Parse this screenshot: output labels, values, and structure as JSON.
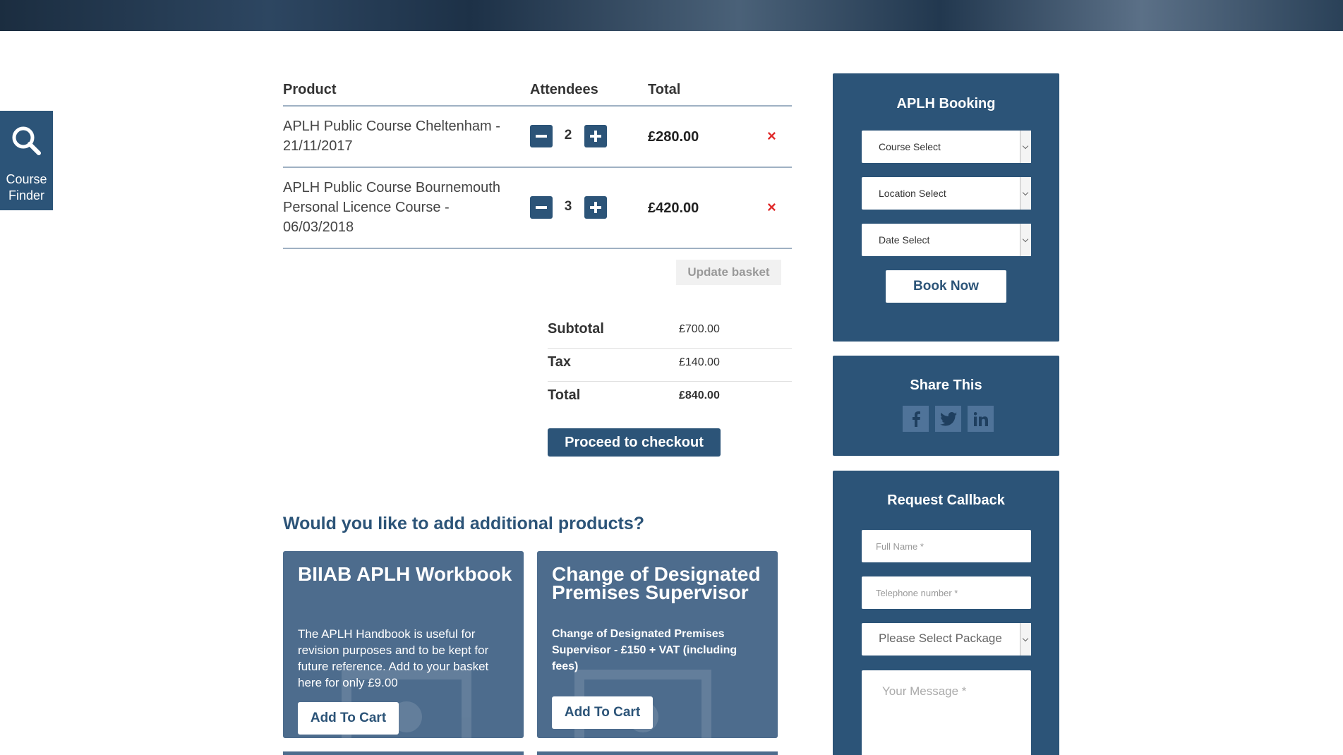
{
  "course_finder": {
    "label_line1": "Course",
    "label_line2": "Finder",
    "icon": "search-icon"
  },
  "cart": {
    "headers": {
      "product": "Product",
      "attendees": "Attendees",
      "total": "Total"
    },
    "items": [
      {
        "name_line1": "APLH Public Course Cheltenham -",
        "name_line2": "21/11/2017",
        "name_line3": "",
        "qty": "2",
        "total": "£280.00",
        "remove": "×"
      },
      {
        "name_line1": "APLH Public Course Bournemouth",
        "name_line2": "Personal Licence Course -",
        "name_line3": "06/03/2018",
        "qty": "3",
        "total": "£420.00",
        "remove": "×"
      }
    ],
    "update_label": "Update basket"
  },
  "totals": {
    "subtotal_label": "Subtotal",
    "subtotal_value": "£700.00",
    "tax_label": "Tax",
    "tax_value": "£140.00",
    "total_label": "Total",
    "total_value": "£840.00"
  },
  "checkout_label": "Proceed to checkout",
  "additional": {
    "title": "Would you like to add additional products?",
    "products": [
      {
        "title": "BIIAB APLH Workbook",
        "desc": "The APLH Handbook is useful for revision purposes and to be kept for future reference. Add to your basket here for only £9.00",
        "button": "Add To Cart"
      },
      {
        "title": "Change of Designated Premises Supervisor",
        "desc": "Change of Designated Premises Supervisor - £150 + VAT (including fees)",
        "button": "Add To Cart"
      }
    ]
  },
  "booking": {
    "title": "APLH Booking",
    "course_select": "Course Select",
    "location_select": "Location Select",
    "date_select": "Date Select",
    "book_now": "Book Now"
  },
  "share": {
    "title": "Share This",
    "icons": [
      "facebook-icon",
      "twitter-icon",
      "linkedin-icon"
    ]
  },
  "callback": {
    "title": "Request Callback",
    "full_name_placeholder": "Full Name *",
    "telephone_placeholder": "Telephone number *",
    "package_select": "Please Select Package",
    "message_placeholder": "Your Message *"
  },
  "colors": {
    "primary": "#2c5478",
    "card": "#4d6c8d",
    "remove": "#e02b2b"
  }
}
